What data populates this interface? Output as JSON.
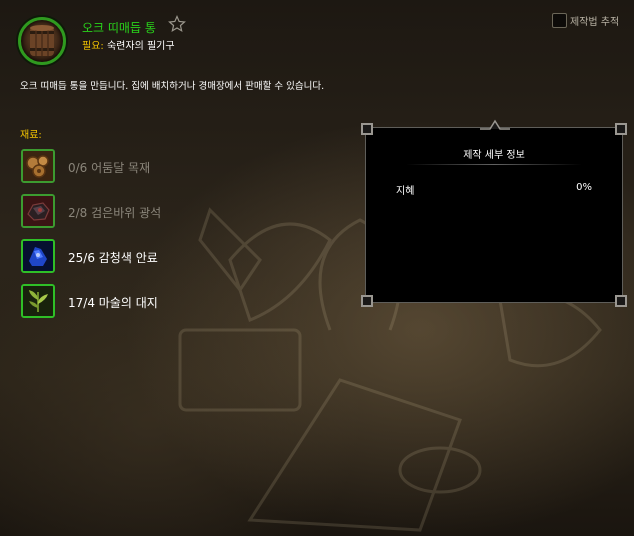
{
  "recipe": {
    "title": "오크 띠매듭 통",
    "requires_label": "필요:",
    "requires_value": "숙련자의 필기구",
    "description": "오크 띠매듭 통을 만듭니다. 집에 배치하거나 경매장에서 판매할 수 있습니다.",
    "icon": "barrel-icon"
  },
  "track_recipe": {
    "label": "제작법 추적",
    "checked": false
  },
  "reagents": {
    "label": "재료:",
    "items": [
      {
        "text": "0/6 어둠달 목재",
        "have": 0,
        "need": 6,
        "icon": "lumber-icon"
      },
      {
        "text": "2/8 검은바위 광석",
        "have": 2,
        "need": 8,
        "icon": "ore-icon"
      },
      {
        "text": "25/6 감청색 안료",
        "have": 25,
        "need": 6,
        "icon": "pigment-icon"
      },
      {
        "text": "17/4 마술의 대지",
        "have": 17,
        "need": 4,
        "icon": "herb-icon"
      }
    ]
  },
  "crafting_details": {
    "title": "제작 세부 정보",
    "stats": [
      {
        "name": "지혜",
        "value": "0%"
      }
    ]
  },
  "colors": {
    "title_green": "#29d21b",
    "label_yellow": "#f3c400",
    "icon_border_green": "#2fbf27"
  }
}
